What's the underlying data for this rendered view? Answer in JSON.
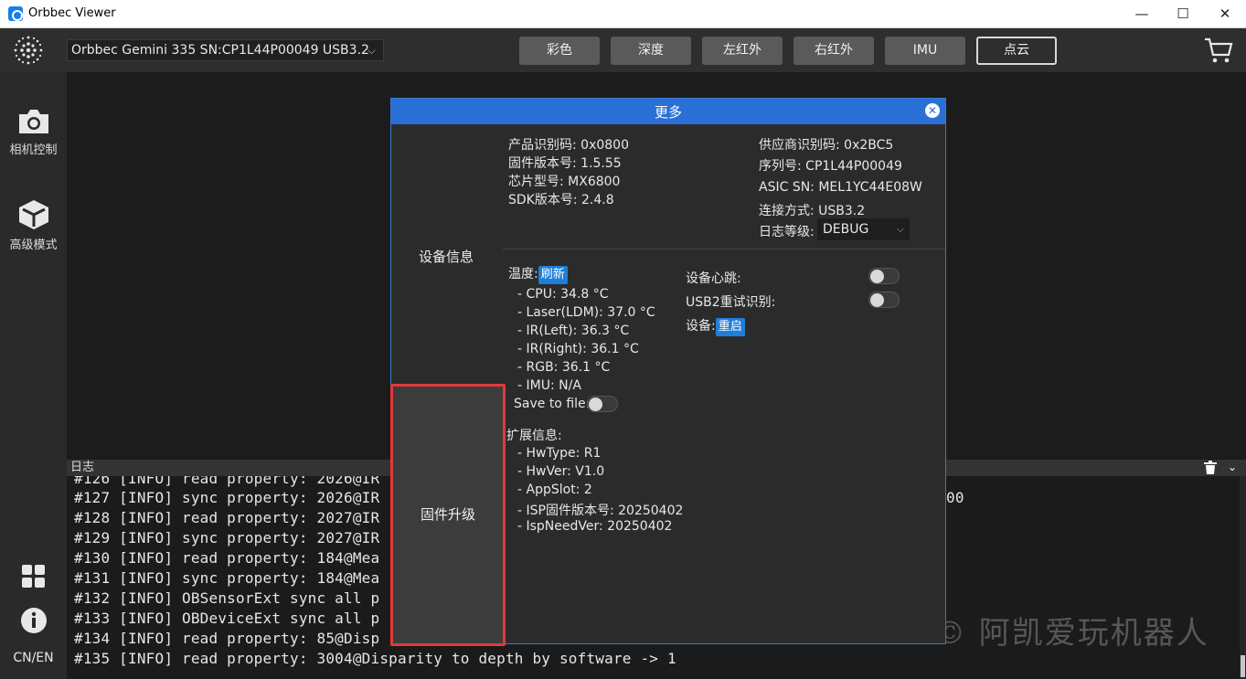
{
  "window": {
    "title": "Orbbec Viewer",
    "minimize": "—",
    "maximize": "☐",
    "close": "✕"
  },
  "topbar": {
    "device": "Orbbec Gemini 335 SN:CP1L44P00049 USB3.2",
    "tabs": [
      "彩色",
      "深度",
      "左红外",
      "右红外",
      "IMU",
      "点云"
    ],
    "active_tab": "点云"
  },
  "sidebar": {
    "items": [
      {
        "label": "相机控制",
        "icon": "camera-icon"
      },
      {
        "label": "高级模式",
        "icon": "cube-icon"
      }
    ],
    "bottom": {
      "apps_icon": "grid-icon",
      "info_icon": "info-icon",
      "lang": "CN/EN"
    }
  },
  "log": {
    "title": "日志",
    "lines": [
      "#126 [INFO] read property: 2026@IR",
      "#127 [INFO] sync property: 2026@IR",
      "#128 [INFO] read property: 2027@IR",
      "#129 [INFO] sync property: 2027@IR",
      "#130 [INFO] read property: 184@Mea",
      "#131 [INFO] sync property: 184@Mea",
      "#132 [INFO] OBSensorExt sync all p",
      "#133 [INFO] OBDeviceExt sync all p",
      "#134 [INFO] read property: 85@Disp",
      "#135 [INFO] read property: 3004@Disparity to depth by software -> 1"
    ],
    "right_fragment": "00"
  },
  "watermark": "© 阿凯爱玩机器人",
  "dialog": {
    "title": "更多",
    "nav": {
      "device_info": "设备信息",
      "firmware_upgrade": "固件升级"
    },
    "left_info": [
      "产品识别码: 0x0800",
      "固件版本号: 1.5.55",
      "芯片型号: MX6800",
      "SDK版本号: 2.4.8"
    ],
    "right_info": [
      "供应商识别码: 0x2BC5",
      "序列号:  CP1L44P00049",
      "ASIC SN:  MEL1YC44E08W",
      "连接方式: USB3.2"
    ],
    "log_level_label": "日志等级:",
    "log_level_value": "DEBUG",
    "temperature_label": "温度:",
    "refresh": "刷新",
    "temps": [
      "- CPU: 34.8 °C",
      "- Laser(LDM): 37.0 °C",
      "- IR(Left): 36.3 °C",
      "- IR(Right): 36.1 °C",
      "- RGB: 36.1 °C",
      "- IMU: N/A"
    ],
    "save_to_file": "Save to file:",
    "heartbeat": "设备心跳:",
    "usb2_retry": "USB2重试识别:",
    "device_label": "设备:",
    "reboot": "重启",
    "ext_title": "扩展信息:",
    "ext": [
      "- HwType: R1",
      "- HwVer: V1.0",
      "- AppSlot: 2",
      "- ISP固件版本号: 20250402",
      "- IspNeedVer: 20250402"
    ]
  }
}
